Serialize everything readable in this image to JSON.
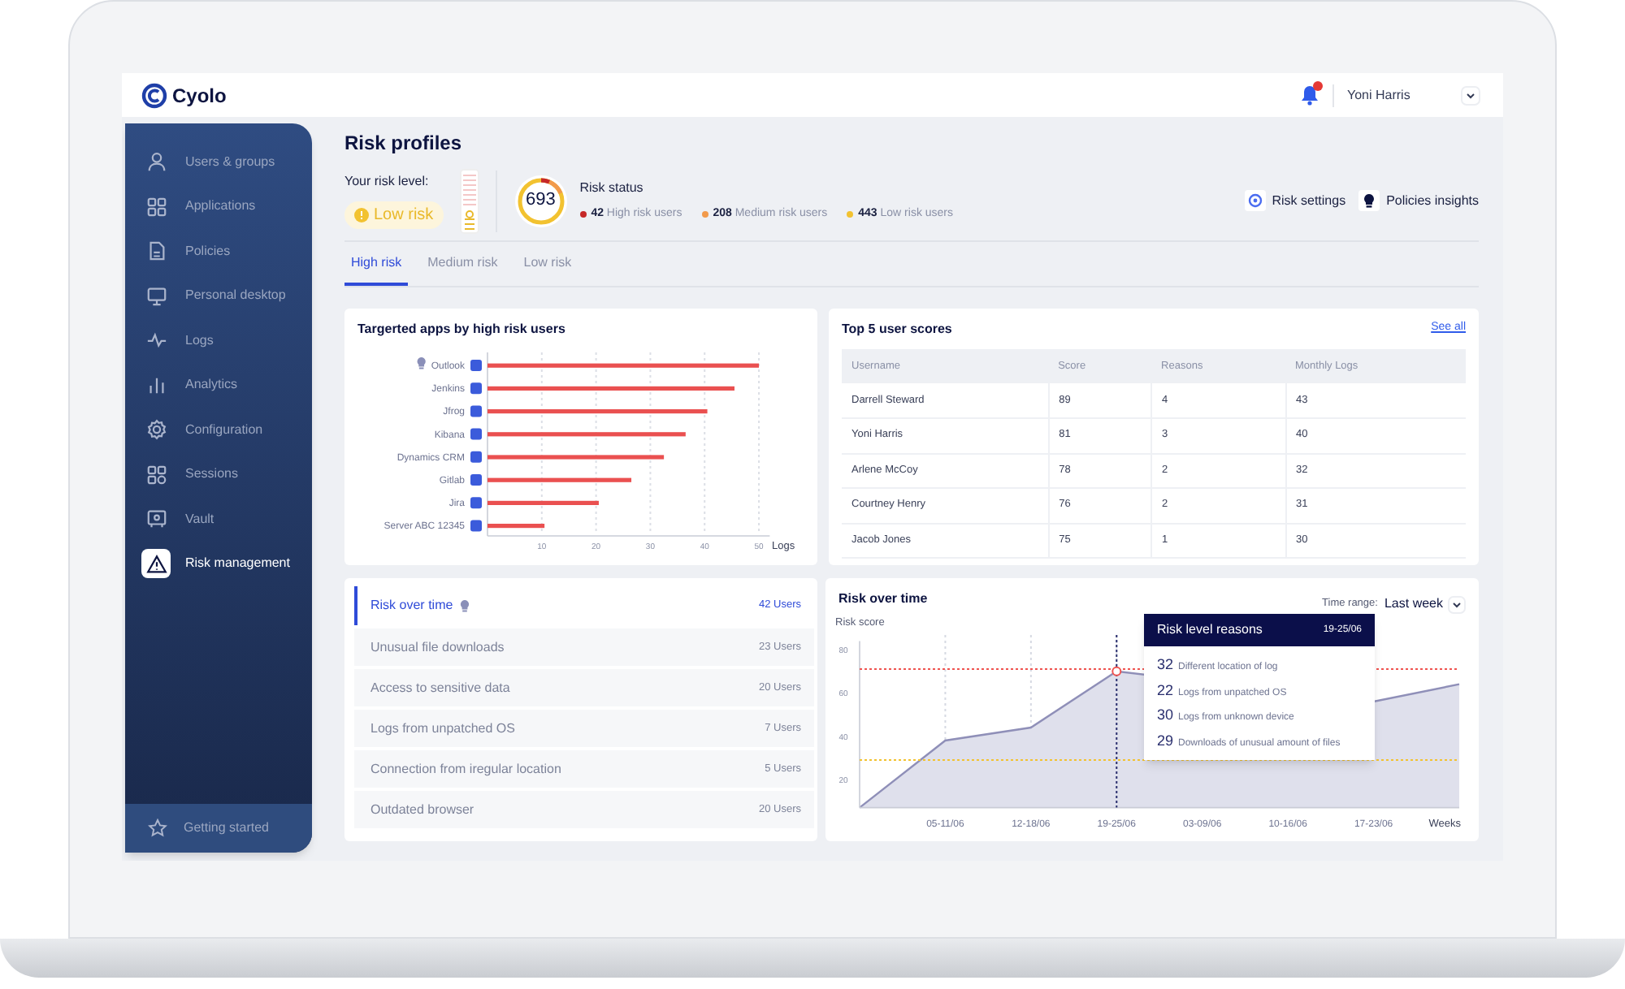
{
  "header": {
    "logo": "Cyolo",
    "notifications": true,
    "user": "Yoni Harris"
  },
  "sidebar": {
    "items": [
      {
        "label": "Users & groups",
        "selected": false
      },
      {
        "label": "Applications",
        "selected": false
      },
      {
        "label": "Policies",
        "selected": false
      },
      {
        "label": "Personal desktop",
        "selected": false
      },
      {
        "label": "Logs",
        "selected": false
      },
      {
        "label": "Analytics",
        "selected": false
      },
      {
        "label": "Configuration",
        "selected": false
      },
      {
        "label": "Sessions",
        "selected": false
      },
      {
        "label": "Vault",
        "selected": false
      },
      {
        "label": "Risk management",
        "selected": true
      }
    ],
    "footer": "Getting started"
  },
  "page": {
    "title": "Risk profiles"
  },
  "risk_level": {
    "label": "Your risk level:",
    "value": "Low risk"
  },
  "risk_status": {
    "score": "693",
    "title": "Risk status",
    "stats": [
      {
        "count": "42",
        "label": "High risk users",
        "color": "#c62828"
      },
      {
        "count": "208",
        "label": "Medium risk users",
        "color": "#f29a4b"
      },
      {
        "count": "443",
        "label": "Low risk users",
        "color": "#f2c230"
      }
    ]
  },
  "actions": [
    "Risk settings",
    "Policies insights"
  ],
  "tabs": [
    {
      "label": "High risk",
      "selected": true
    },
    {
      "label": "Medium risk",
      "selected": false
    },
    {
      "label": "Low risk",
      "selected": false
    }
  ],
  "apps_card": {
    "insight_flags": [
      true,
      false,
      false,
      false,
      false,
      false,
      false,
      false
    ],
    "chart_data": {
      "type": "bar",
      "orientation": "horizontal",
      "title": "Targerted apps by high risk users",
      "xlabel": "Logs",
      "categories": [
        "Outlook",
        "Jenkins",
        "Jfrog",
        "Kibana",
        "Dynamics CRM",
        "Gitlab",
        "Jira",
        "Server ABC 12345"
      ],
      "values": [
        50,
        45.5,
        40.5,
        36.5,
        32.5,
        26.5,
        20.5,
        10.5
      ],
      "xlim": [
        0,
        52
      ],
      "xticks": [
        10,
        20,
        30,
        40,
        50
      ],
      "grid": true
    }
  },
  "scores_card": {
    "title": "Top 5 user scores",
    "link": "See all",
    "columns": [
      "Username",
      "Score",
      "Reasons",
      "Monthly Logs"
    ],
    "rows": [
      [
        "Darrell Steward",
        "89",
        "4",
        "43"
      ],
      [
        "Yoni Harris",
        "81",
        "3",
        "40"
      ],
      [
        "Arlene McCoy",
        "78",
        "2",
        "32"
      ],
      [
        "Courtney Henry",
        "76",
        "2",
        "31"
      ],
      [
        "Jacob Jones",
        "75",
        "1",
        "30"
      ]
    ]
  },
  "reasons_list": [
    {
      "label": "Risk over time",
      "count": "42 Users",
      "selected": true,
      "insight": true
    },
    {
      "label": "Unusual file downloads",
      "count": "23 Users",
      "selected": false,
      "insight": false
    },
    {
      "label": "Access to sensitive data",
      "count": "20 Users",
      "selected": false,
      "insight": false
    },
    {
      "label": "Logs from unpatched OS",
      "count": "7 Users",
      "selected": false,
      "insight": false
    },
    {
      "label": "Connection from iregular location",
      "count": "5 Users",
      "selected": false,
      "insight": false
    },
    {
      "label": "Outdated browser",
      "count": "20 Users",
      "selected": false,
      "insight": false
    }
  ],
  "risk_chart": {
    "time_range_label": "Time range:",
    "time_range": "Last week",
    "chart_data": {
      "type": "area",
      "title": "Risk over time",
      "ylabel": "Risk score",
      "xlabel": "Weeks",
      "categories": [
        null,
        "05-11/06",
        "12-18/06",
        "19-25/06",
        "03-09/06",
        "10-16/06",
        "17-23/06",
        null
      ],
      "series": [
        {
          "color": "#8f8fb8",
          "values": [
            7,
            38,
            44,
            70,
            null,
            null,
            56,
            64
          ]
        }
      ],
      "ylim": [
        7,
        84
      ],
      "yticks": [
        20,
        40,
        60,
        80
      ],
      "ref_lines": [
        {
          "axis": "y",
          "value": 71,
          "color": "#ef5350"
        },
        {
          "axis": "y",
          "value": 29,
          "color": "#f2c230"
        },
        {
          "axis": "x",
          "value": "19-25/06",
          "color": "#2a2f6e"
        }
      ],
      "grid": true
    },
    "tooltip": {
      "title": "Risk level reasons",
      "date": "19-25/06",
      "reasons": [
        {
          "count": "32",
          "text": "Different location of log"
        },
        {
          "count": "22",
          "text": "Logs from unpatched OS"
        },
        {
          "count": "30",
          "text": "Logs from unknown device"
        },
        {
          "count": "29",
          "text": "Downloads of unusual amount of files"
        }
      ]
    }
  }
}
